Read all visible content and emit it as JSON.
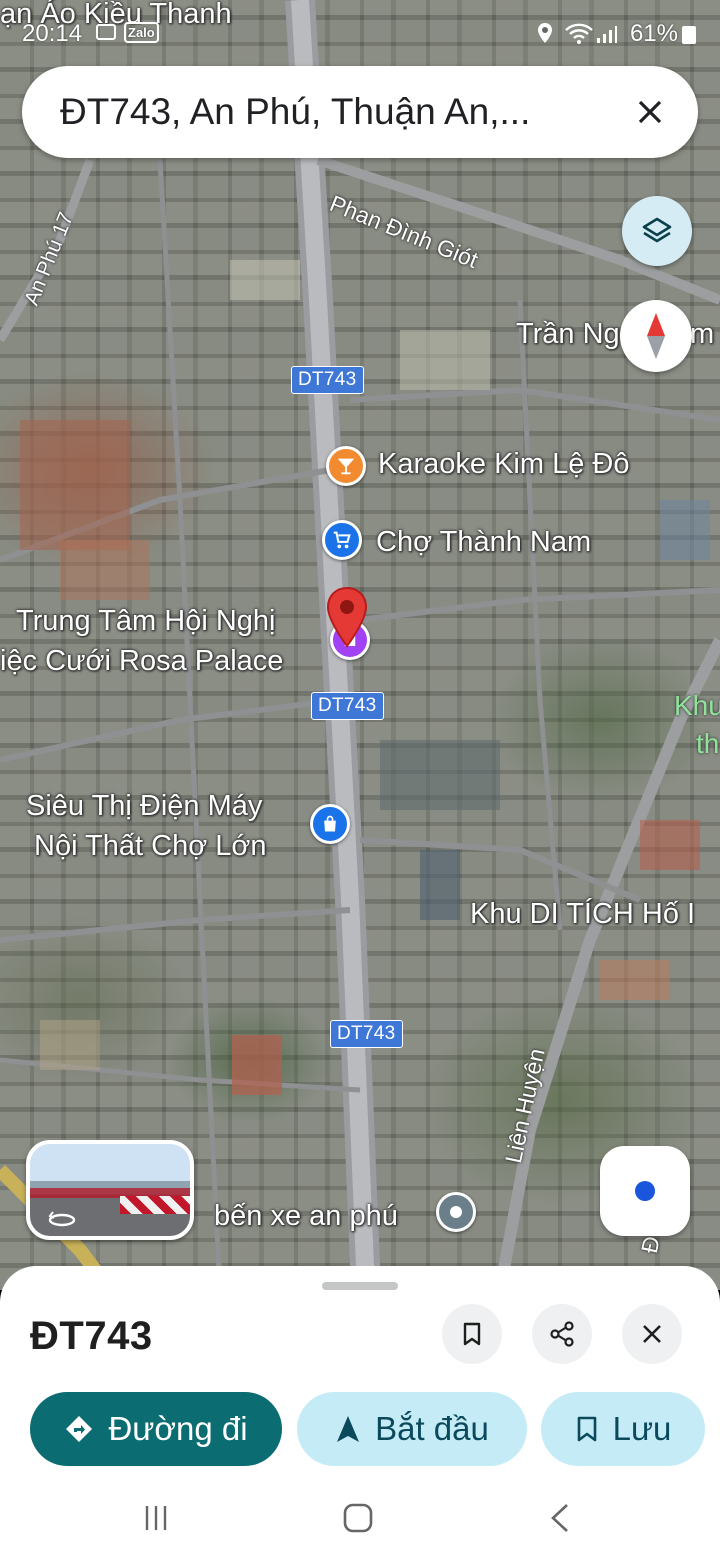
{
  "status_bar": {
    "time": "20:14",
    "app_badge": "Zalo",
    "battery": "61%"
  },
  "search": {
    "query": "ĐT743, An Phú, Thuận An,..."
  },
  "map": {
    "streets": {
      "phan_dinh_giot": "Phan Đình Giót",
      "an_phu_17": "An Phú 17",
      "tran_ngoc": "Trần Ng",
      "tran_suffix": "m I",
      "lien_huyen": "Liên Huyện",
      "edge_road": "Đ"
    },
    "shields": {
      "s1": "DT743",
      "s2": "DT743",
      "s3": "DT743"
    },
    "places": {
      "top_shop": "ạn Áo Kiều Thanh",
      "karaoke": "Karaoke Kim Lệ Đô",
      "market": "Chợ Thành Nam",
      "conference_1": "Trung Tâm Hội Nghị",
      "conference_2": "iệc Cưới Rosa Palace",
      "electronics_1": "Siêu Thị Điện Máy",
      "electronics_2": "Nội Thất Chợ Lớn",
      "relic": "Khu DI TÍCH Hố I",
      "bus_station": "bến xe an phú",
      "green_1": "Khu",
      "green_2": "th"
    },
    "colors": {
      "pin": "#e53935",
      "karaoke": "#f28b30",
      "market": "#1a73e8",
      "shield": "#3f77d6"
    }
  },
  "sheet": {
    "title": "ĐT743",
    "directions_label": "Đường đi",
    "start_label": "Bắt đầu",
    "save_label": "Lưu",
    "accent": "#0b6c71"
  },
  "icons": {
    "layers": "layers-icon",
    "compass": "compass-icon",
    "locate": "my-location-icon",
    "bookmark": "bookmark-icon",
    "share": "share-icon",
    "close": "close-icon"
  }
}
